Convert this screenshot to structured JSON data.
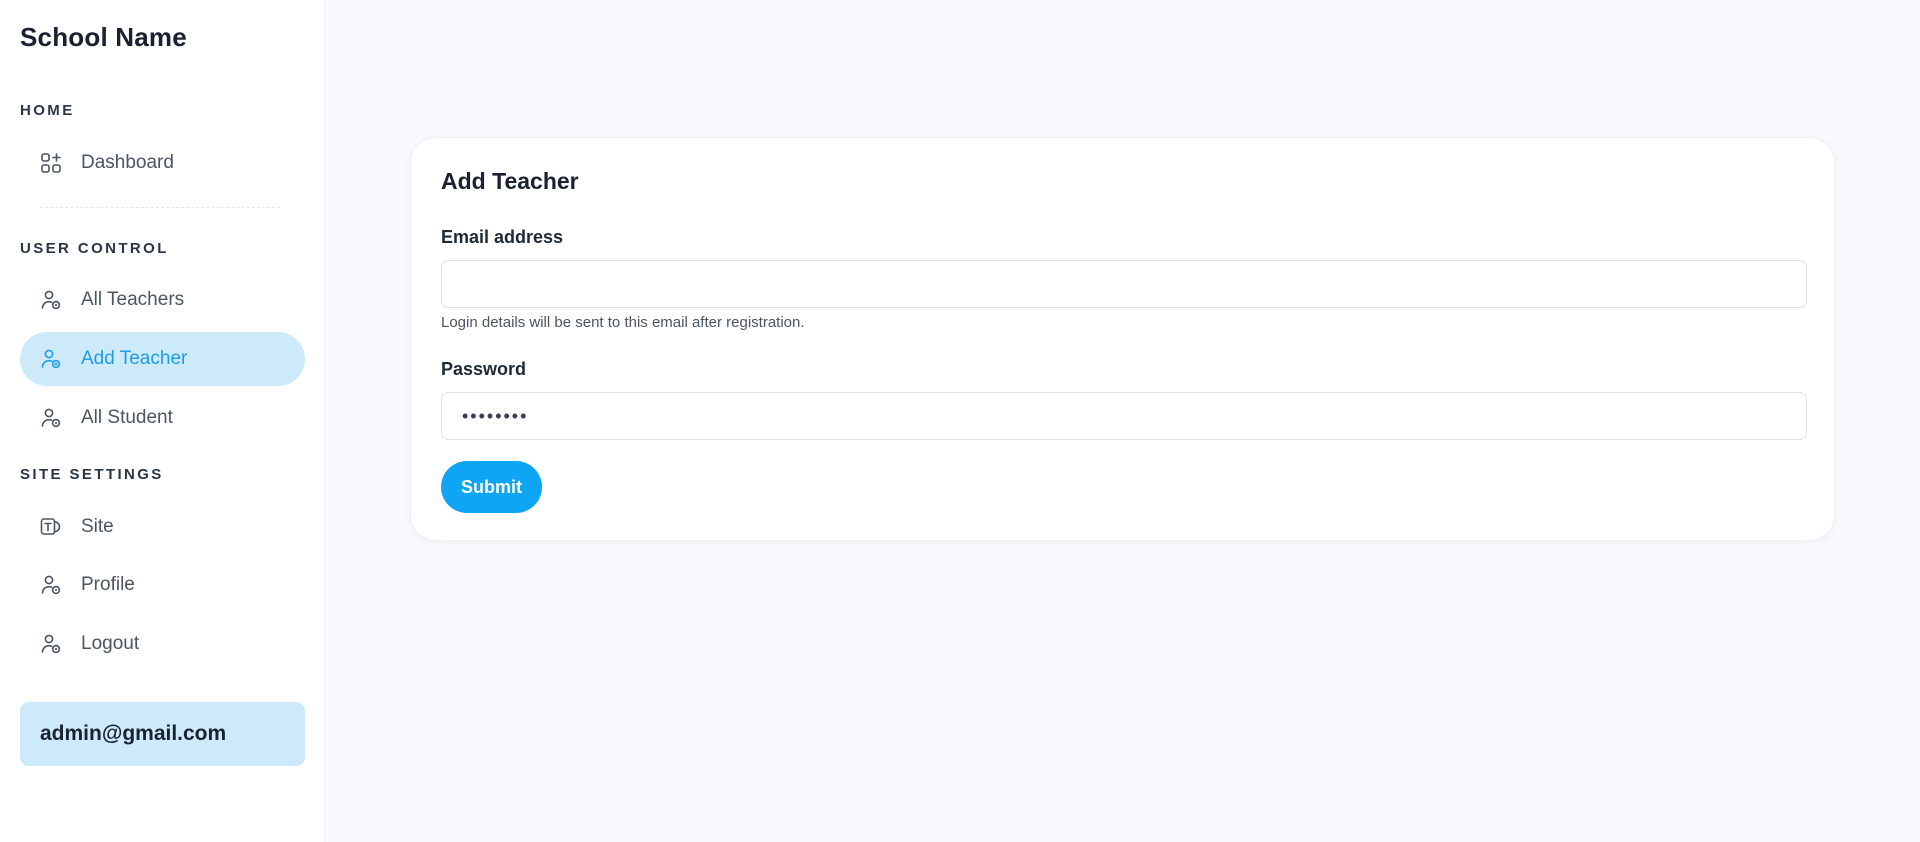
{
  "sidebar": {
    "brand": "School Name",
    "sections": {
      "home": "HOME",
      "user_control": "USER CONTROL",
      "site_settings": "SITE SETTINGS"
    },
    "items": {
      "dashboard": {
        "label": "Dashboard",
        "icon": "grid-plus-icon"
      },
      "all_teachers": {
        "label": "All Teachers",
        "icon": "user-settings-icon"
      },
      "add_teacher": {
        "label": "Add Teacher",
        "icon": "user-settings-icon",
        "active": true
      },
      "all_student": {
        "label": "All Student",
        "icon": "user-settings-icon"
      },
      "site": {
        "label": "Site",
        "icon": "text-box-icon"
      },
      "profile": {
        "label": "Profile",
        "icon": "user-settings-icon"
      },
      "logout": {
        "label": "Logout",
        "icon": "user-settings-icon"
      }
    },
    "user_email": "admin@gmail.com"
  },
  "form": {
    "title": "Add Teacher",
    "email": {
      "label": "Email address",
      "value": "",
      "hint": "Login details will be sent to this email after registration."
    },
    "password": {
      "label": "Password",
      "value": "••••••••"
    },
    "submit_label": "Submit"
  },
  "colors": {
    "accent": "#0ea5f5",
    "active_bg": "#cdeafb",
    "active_text": "#1e9ce6",
    "page_bg": "#f8f9fc"
  }
}
